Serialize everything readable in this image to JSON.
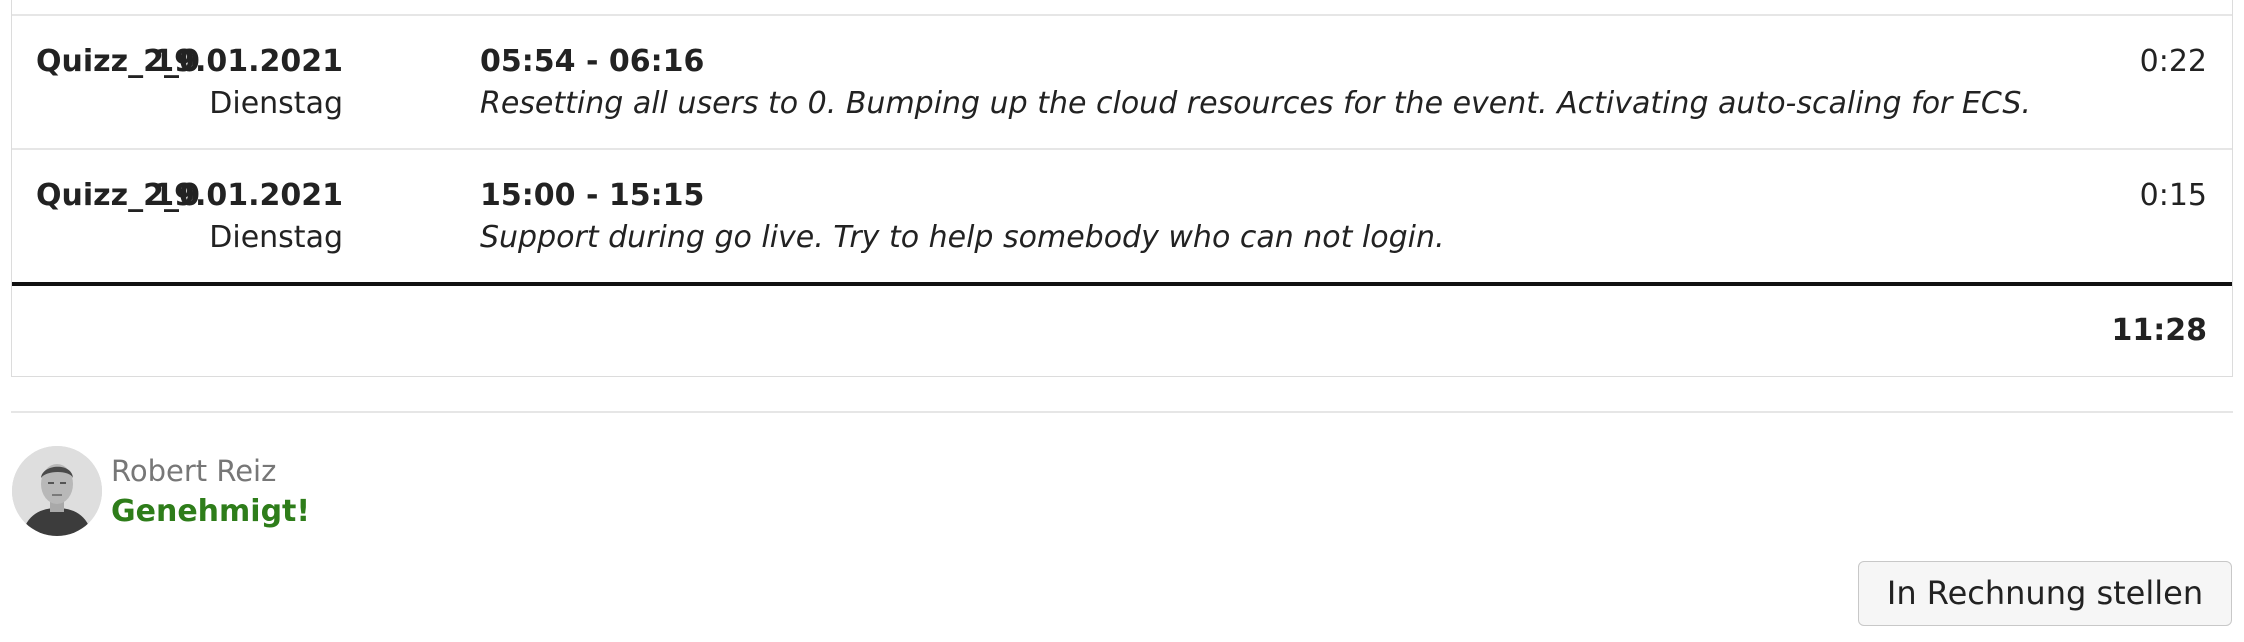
{
  "entries": [
    {
      "project": "Quizz_2_0",
      "date": "19.01.2021",
      "weekday": "Dienstag",
      "time_range": "05:54 - 06:16",
      "description": "Resetting all users to 0. Bumping up the cloud resources for the event. Activating auto-scaling for ECS.",
      "duration": "0:22"
    },
    {
      "project": "Quizz_2_0",
      "date": "19.01.2021",
      "weekday": "Dienstag",
      "time_range": "15:00 - 15:15",
      "description": "Support during go live. Try to help somebody who can not login.",
      "duration": "0:15"
    }
  ],
  "total": "11:28",
  "approval": {
    "author": "Robert Reiz",
    "status": "Genehmigt!",
    "status_color": "#2e7d1a"
  },
  "actions": {
    "invoice_label": "In Rechnung stellen"
  }
}
